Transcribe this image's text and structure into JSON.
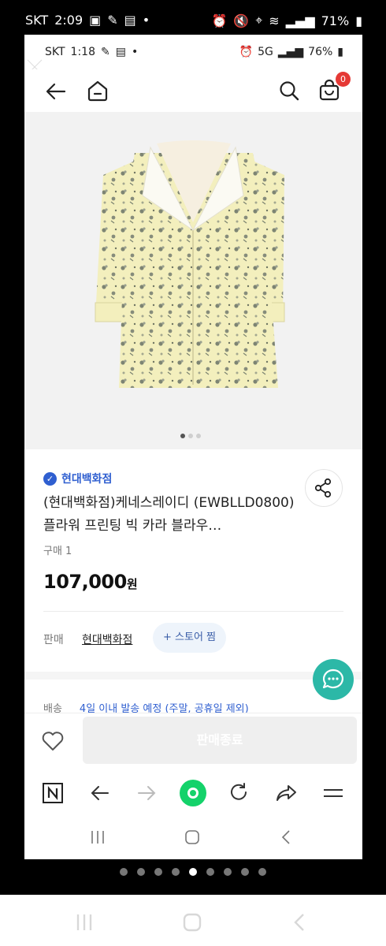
{
  "outer_status": {
    "carrier": "SKT",
    "time": "2:09",
    "battery": "71%"
  },
  "inner_status": {
    "carrier": "SKT",
    "time": "1:18",
    "battery": "76%"
  },
  "cart": {
    "count": "0"
  },
  "product": {
    "store": "현대백화점",
    "title": "(현대백화점)케네스레이디 (EWBLLD0800) 플라워 프린팅 빅 카라 블라우…",
    "purchase_count": "구매 1",
    "price": "107,000",
    "currency": "원"
  },
  "seller": {
    "label": "판매",
    "name": "현대백화점",
    "store_fav": "+ 스토어 찜"
  },
  "shipping": {
    "label": "배송",
    "text": "4일 이내 발송 예정 (주말, 공휴일 제외)"
  },
  "bottom": {
    "buy_button": "판매종료"
  },
  "carousel": {
    "image_count": 3,
    "current": 1
  },
  "outer_pager": {
    "count": 9,
    "current": 5
  }
}
